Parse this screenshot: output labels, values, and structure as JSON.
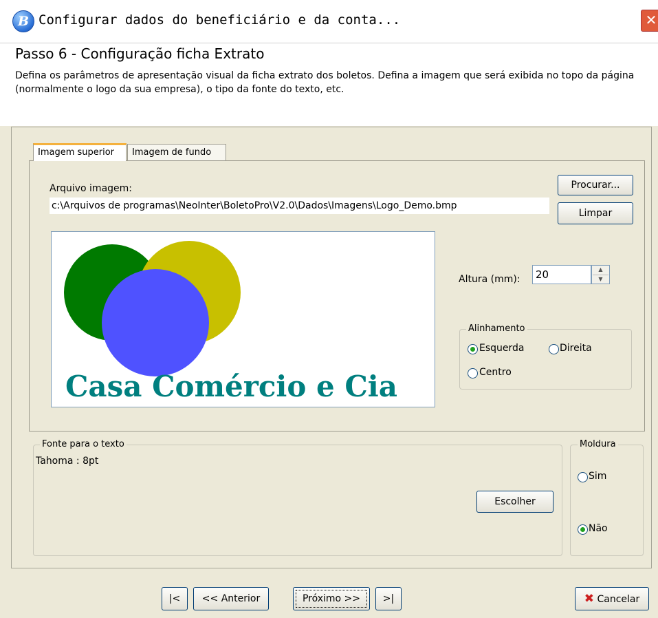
{
  "window": {
    "title": "Configurar dados do beneficiário e da conta...",
    "app_icon_glyph": "B",
    "close_glyph": "✕"
  },
  "header": {
    "step_title": "Passo 6 - Configuração ficha Extrato",
    "description": "Defina os parâmetros de apresentação visual da ficha extrato dos boletos. Defina a imagem que será exibida no topo da página (normalmente o logo da sua empresa), o tipo da fonte do texto, etc."
  },
  "tabs": [
    {
      "label": "Imagem superior",
      "active": true
    },
    {
      "label": "Imagem de fundo",
      "active": false
    }
  ],
  "image_tab": {
    "file_label": "Arquivo imagem:",
    "file_path": "c:\\Arquivos de programas\\NeoInter\\BoletoPro\\V2.0\\Dados\\Imagens\\Logo_Demo.bmp",
    "browse_button": "Procurar...",
    "clear_button": "Limpar",
    "preview_caption": "Casa Comércio e Cia",
    "height_label": "Altura (mm):",
    "height_value": "20",
    "alignment": {
      "legend": "Alinhamento",
      "options": [
        "Esquerda",
        "Direita",
        "Centro"
      ],
      "selected": "Esquerda"
    }
  },
  "font_group": {
    "legend": "Fonte para o texto",
    "value": "Tahoma : 8pt",
    "choose_button": "Escolher"
  },
  "frame_group": {
    "legend": "Moldura",
    "options": [
      "Sim",
      "Não"
    ],
    "selected": "Não"
  },
  "footer": {
    "first_button": "|<",
    "prev_button": "<< Anterior",
    "next_button": "Próximo >>",
    "last_button": ">|",
    "cancel_button": "Cancelar",
    "cancel_icon_glyph": "✖"
  },
  "colors": {
    "preview_green": "#007a00",
    "preview_yellow": "#c8c000",
    "preview_blue": "#4f52ff",
    "preview_text": "#007f7f",
    "cancel_icon": "#cc1f1f",
    "tab_accent": "#f4b13e"
  }
}
